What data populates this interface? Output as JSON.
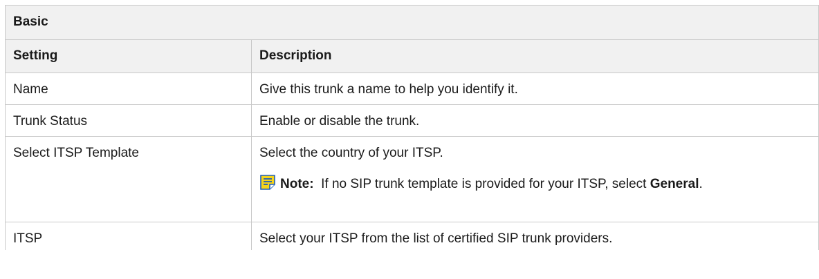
{
  "table": {
    "section_title": "Basic",
    "columns": {
      "setting": "Setting",
      "description": "Description"
    },
    "rows": [
      {
        "setting": "Name",
        "description": "Give this trunk a name to help you identify it."
      },
      {
        "setting": "Trunk Status",
        "description": "Enable or disable the trunk."
      },
      {
        "setting": "Select ITSP Template",
        "description": "Select the country of your ITSP.",
        "note": {
          "label": "Note:",
          "text_before": "If no SIP trunk template is provided for your ITSP, select",
          "emphasis": "General",
          "text_after": "."
        }
      },
      {
        "setting": "ITSP",
        "description": "Select your ITSP from the list of certified SIP trunk providers."
      }
    ]
  },
  "colors": {
    "note_icon_fill": "#f5d31a",
    "note_icon_stroke": "#1f5fb8",
    "header_background": "#f1f1f1",
    "border": "#c8c8c8"
  },
  "icons": {
    "note": "note-icon"
  }
}
